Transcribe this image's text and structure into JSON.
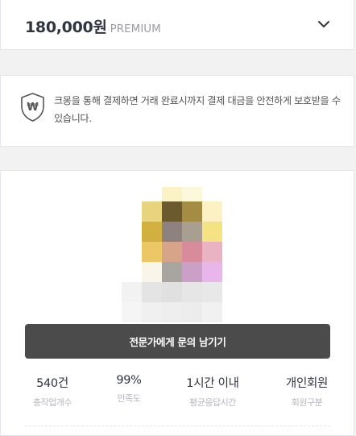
{
  "price": {
    "amount": "180,000원",
    "grade": "PREMIUM"
  },
  "notice": {
    "text": "크몽을 통해 결제하면 거래 완료시까지 결제 대금을 안전하게 보호받을 수 있습니다.",
    "shield_symbol": "₩"
  },
  "expert": {
    "contact_button": "전문가에게 문의 남기기",
    "stats": [
      {
        "value": "540건",
        "label": "총작업개수"
      },
      {
        "value": "99%",
        "label": "만족도"
      },
      {
        "value": "1시간 이내",
        "label": "평균응답시간"
      },
      {
        "value": "개인회원",
        "label": "회원구분"
      }
    ]
  },
  "icons": {
    "expand": "chevron-down-icon",
    "safe_payment": "shield-won-icon"
  },
  "colors": {
    "button_bg": "#4c4b4c",
    "label_gray": "#b5b6c0",
    "text_dark": "#303441"
  }
}
